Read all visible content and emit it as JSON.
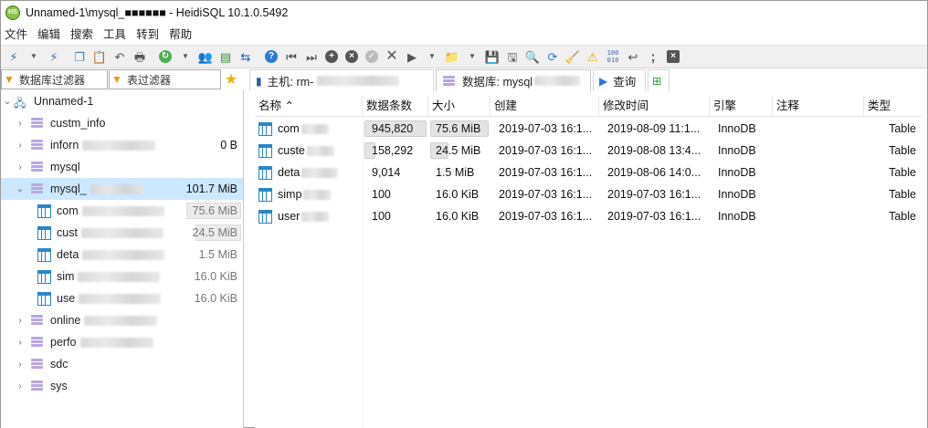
{
  "window": {
    "title": "Unnamed-1\\mysql_■■■■■■ - HeidiSQL 10.1.0.5492",
    "icon": "heidisql-icon"
  },
  "menu": [
    "文件",
    "编辑",
    "搜索",
    "工具",
    "转到",
    "帮助"
  ],
  "filters": {
    "db_filter_placeholder": "数据库过滤器",
    "table_filter_placeholder": "表过滤器"
  },
  "tree": {
    "session": "Unnamed-1",
    "items": [
      {
        "name": "custm_info",
        "size": "",
        "type": "database"
      },
      {
        "name": "inforn",
        "size": "0 B",
        "type": "database"
      },
      {
        "name": "mysql",
        "size": "",
        "type": "database"
      },
      {
        "name": "mysql_",
        "size": "101.7 MiB",
        "type": "database",
        "selected": true
      },
      {
        "name": "com",
        "size": "75.6 MiB",
        "type": "table"
      },
      {
        "name": "cust",
        "size": "24.5 MiB",
        "type": "table"
      },
      {
        "name": "deta",
        "size": "1.5 MiB",
        "type": "table"
      },
      {
        "name": "sim",
        "size": "16.0 KiB",
        "type": "table"
      },
      {
        "name": "use",
        "size": "16.0 KiB",
        "type": "table"
      },
      {
        "name": "online",
        "size": "",
        "type": "database"
      },
      {
        "name": "perfo",
        "size": "",
        "type": "database"
      },
      {
        "name": "sdc",
        "size": "",
        "type": "database"
      },
      {
        "name": "sys",
        "size": "",
        "type": "database"
      }
    ]
  },
  "tabs": [
    {
      "label": "主机: rm-",
      "icon": "server-icon"
    },
    {
      "label": "数据库: mysql",
      "icon": "database-icon",
      "active": true
    },
    {
      "label": "查询",
      "icon": "play-icon"
    }
  ],
  "table_columns": [
    "名称",
    "数据条数",
    "大小",
    "创建",
    "修改时间",
    "引擎",
    "注释",
    "类型"
  ],
  "table_rows": [
    {
      "name": "com",
      "rows": "945,820",
      "size": "75.6 MiB",
      "created": "2019-07-03 16:1...",
      "modified": "2019-08-09 11:1...",
      "engine": "InnoDB",
      "comment": "",
      "type": "Table",
      "rows_frac": 1.0,
      "size_frac": 1.0
    },
    {
      "name": "custe",
      "rows": "158,292",
      "size": "24.5 MiB",
      "created": "2019-07-03 16:1...",
      "modified": "2019-08-08 13:4...",
      "engine": "InnoDB",
      "comment": "",
      "type": "Table",
      "rows_frac": 0.17,
      "size_frac": 0.32
    },
    {
      "name": "deta",
      "rows": "9,014",
      "size": "1.5 MiB",
      "created": "2019-07-03 16:1...",
      "modified": "2019-08-06 14:0...",
      "engine": "InnoDB",
      "comment": "",
      "type": "Table",
      "rows_frac": 0.01,
      "size_frac": 0.02
    },
    {
      "name": "simp",
      "rows": "100",
      "size": "16.0 KiB",
      "created": "2019-07-03 16:1...",
      "modified": "2019-07-03 16:1...",
      "engine": "InnoDB",
      "comment": "",
      "type": "Table",
      "rows_frac": 0.0,
      "size_frac": 0.0
    },
    {
      "name": "user",
      "rows": "100",
      "size": "16.0 KiB",
      "created": "2019-07-03 16:1...",
      "modified": "2019-07-03 16:1...",
      "engine": "InnoDB",
      "comment": "",
      "type": "Table",
      "rows_frac": 0.0,
      "size_frac": 0.0
    }
  ],
  "toolbar_icons": [
    "connect-icon",
    "disconnect-icon",
    "copy-icon",
    "paste-icon",
    "undo-icon",
    "print-icon",
    "refresh-icon",
    "user-manager-icon",
    "export-icon",
    "transfer-icon",
    "help-icon",
    "first-icon",
    "last-icon",
    "insert-icon",
    "delete-icon",
    "post-icon",
    "cancel-icon",
    "run-icon",
    "open-icon",
    "save-icon",
    "save-as-icon",
    "find-icon",
    "replace-icon",
    "clear-icon",
    "warning-icon",
    "binary-icon",
    "wrap-icon",
    "semicolon-icon",
    "close-icon"
  ],
  "colors": {
    "selection": "#cce8ff",
    "table_icon": "#2a86c7",
    "db_icon": "#b9a7df"
  }
}
